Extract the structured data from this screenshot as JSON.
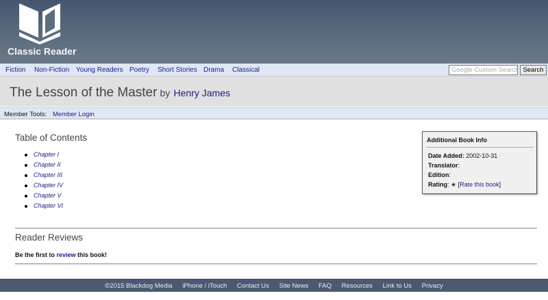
{
  "site": {
    "name": "Classic Reader"
  },
  "nav": {
    "items": [
      "Fiction",
      "Non-Fiction",
      "Young Readers",
      "Poetry",
      "Short Stories",
      "Drama",
      "Classical"
    ],
    "search_placeholder": "Google Custom Search",
    "search_button": "Search"
  },
  "book": {
    "title": "The Lesson of the Master",
    "by": "by",
    "author": "Henry James"
  },
  "member": {
    "label": "Member Tools:",
    "login": "Member Login"
  },
  "toc": {
    "heading": "Table of Contents",
    "chapters": [
      "Chapter I",
      "Chapter II",
      "Chapter III",
      "Chapter IV",
      "Chapter V",
      "Chapter VI"
    ]
  },
  "info": {
    "heading": "Additional Book Info",
    "date_label": "Date Added",
    "date": "2002-10-31",
    "translator_label": "Translator",
    "edition_label": "Edition",
    "rating_label": "Rating",
    "rate_link": "Rate this book"
  },
  "reviews": {
    "heading": "Reader Reviews",
    "pre": "Be the first to ",
    "link": "review",
    "post": " this book!"
  },
  "footer": {
    "items": [
      "©2015 Blackdog Media",
      "iPhone / iTouch",
      "Contact Us",
      "Site News",
      "FAQ",
      "Resources",
      "Link to Us",
      "Privacy"
    ]
  }
}
